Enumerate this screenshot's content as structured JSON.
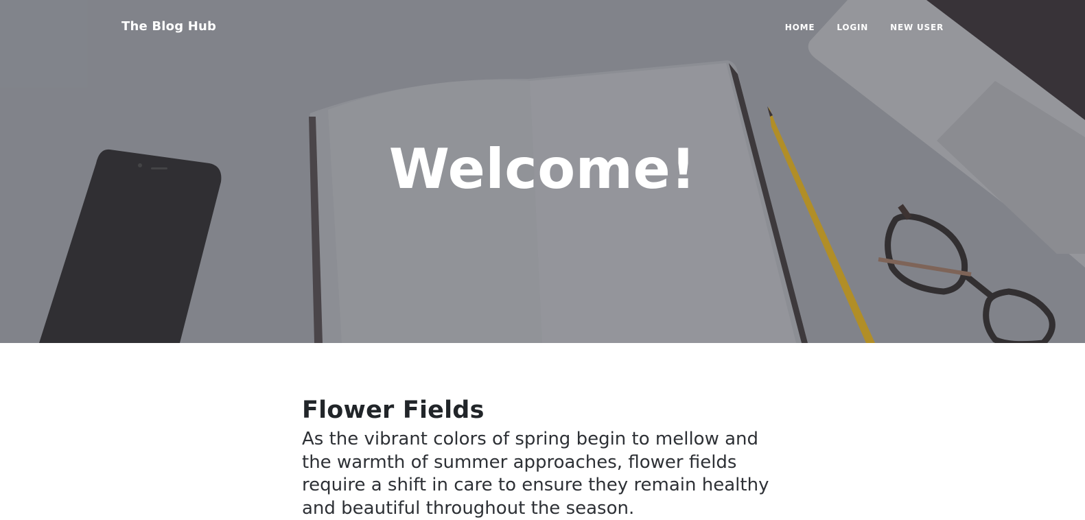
{
  "navbar": {
    "brand": "The Blog Hub",
    "links": [
      {
        "label": "HOME"
      },
      {
        "label": "LOGIN"
      },
      {
        "label": "NEW USER"
      }
    ]
  },
  "hero": {
    "heading": "Welcome!"
  },
  "post": {
    "title": "Flower Fields",
    "excerpt": "As the vibrant colors of spring begin to mellow and the warmth of summer approaches, flower fields require a shift in care to ensure they remain healthy and beautiful throughout the season."
  },
  "colors": {
    "hero_background": "#8c8f96",
    "text_dark": "#212529",
    "text_light": "#ffffff"
  }
}
